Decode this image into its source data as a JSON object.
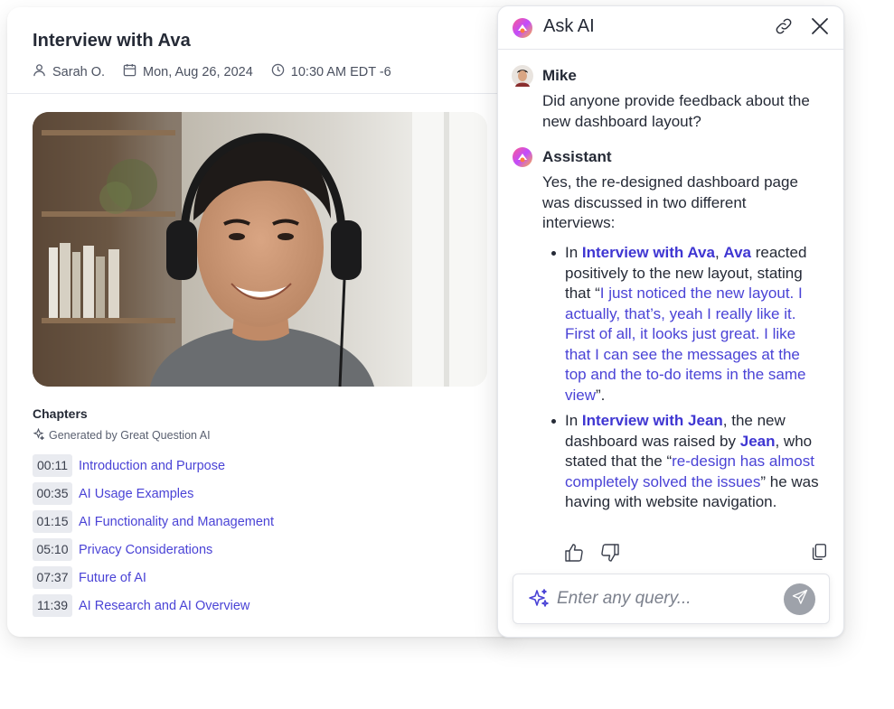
{
  "interview": {
    "title": "Interview with Ava",
    "author": "Sarah O.",
    "date": "Mon, Aug 26, 2024",
    "time": "10:30 AM EDT -6"
  },
  "chapters": {
    "title": "Chapters",
    "generated_by": "Generated by Great Question AI",
    "items": [
      {
        "time": "00:11",
        "label": "Introduction and Purpose"
      },
      {
        "time": "00:35",
        "label": "AI Usage Examples"
      },
      {
        "time": "01:15",
        "label": "AI Functionality and Management"
      },
      {
        "time": "05:10",
        "label": "Privacy Considerations"
      },
      {
        "time": "07:37",
        "label": "Future of AI"
      },
      {
        "time": "11:39",
        "label": "AI Research and AI Overview"
      }
    ]
  },
  "ask_ai": {
    "title": "Ask AI",
    "input_placeholder": "Enter any query...",
    "messages": [
      {
        "author": "Mike",
        "text": "Did anyone provide feedback about the new dashboard layout?"
      },
      {
        "author": "Assistant",
        "text": "Yes, the re-designed dashboard page was discussed in two different interviews:"
      }
    ],
    "bullet_1": {
      "prefix": "In ",
      "ref1": "Interview with Ava",
      "sep": ", ",
      "ref2": "Ava",
      "middle": " reacted positively to the new layout, stating that “",
      "quote": "I just noticed the new layout. I actually, that’s, yeah I really like it. First of all, it looks just great. I like that I can see the messages at the top and the to-do items in the same view",
      "suffix": "”."
    },
    "bullet_2": {
      "prefix": "In ",
      "ref1": "Interview with Jean",
      "middle": ", the new dashboard was raised by ",
      "ref2": "Jean",
      "middle2": ", who stated that the “",
      "quote": "re-design has almost completely solved the issues",
      "suffix": "” he was having with website navigation."
    }
  },
  "colors": {
    "link": "#4a43d6",
    "ref": "#3f36d2",
    "timestamp_bg": "#e9ebf0",
    "send_button": "#9ea2aa"
  },
  "icons": [
    "user-icon",
    "calendar-icon",
    "clock-icon",
    "sparkle-icon",
    "link-icon",
    "close-icon",
    "thumbs-up-icon",
    "thumbs-down-icon",
    "copy-icon",
    "send-icon"
  ]
}
